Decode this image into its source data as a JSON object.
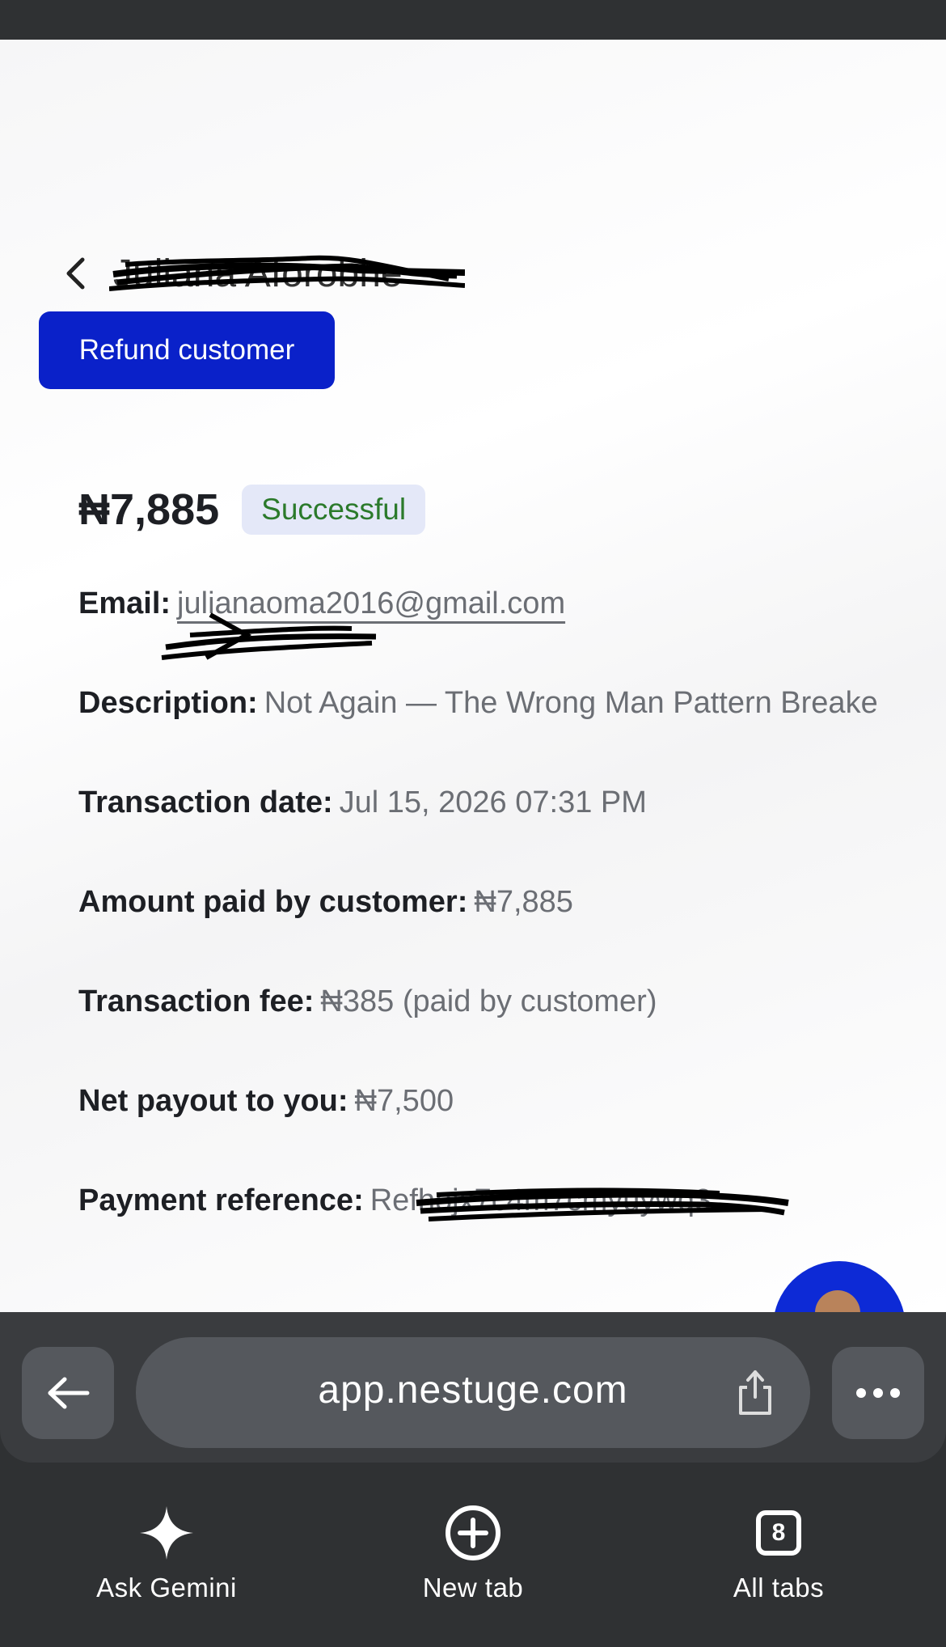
{
  "header": {
    "customer_name": "Juliana Aforobhe"
  },
  "actions": {
    "refund_label": "Refund customer"
  },
  "transaction": {
    "amount": "₦7,885",
    "status": "Successful",
    "fields": [
      {
        "label": "Email:",
        "value": "julianaoma2016@gmail.com"
      },
      {
        "label": "Description:",
        "value": "Not Again — The Wrong Man Pattern Breake"
      },
      {
        "label": "Transaction date:",
        "value": "Jul 15, 2026 07:31 PM"
      },
      {
        "label": "Amount paid by customer:",
        "value": "₦7,885"
      },
      {
        "label": "Transaction fee:",
        "value": "₦385 (paid by customer)"
      },
      {
        "label": "Net payout to you:",
        "value": "₦7,500"
      },
      {
        "label": "Payment reference:",
        "value": "Refhojx7c4m7cmyuywq3"
      }
    ]
  },
  "browser": {
    "url": "app.nestuge.com",
    "nav": [
      {
        "label": "Ask Gemini",
        "icon": "sparkle-icon"
      },
      {
        "label": "New tab",
        "icon": "plus-circle-icon"
      },
      {
        "label": "All tabs",
        "icon": "tabs-icon",
        "count": "8"
      }
    ]
  },
  "colors": {
    "primary_button": "#0a21c9",
    "success_text": "#2b7a2b",
    "badge_bg": "#e4e8f8",
    "browser_chrome": "#2f3133"
  }
}
